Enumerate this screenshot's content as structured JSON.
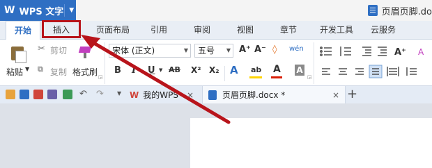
{
  "app": {
    "logo": "W",
    "name": "WPS 文字",
    "caret": "▼"
  },
  "title": {
    "document": "页眉页脚.do"
  },
  "tabs": [
    {
      "label": "开始"
    },
    {
      "label": "插入"
    },
    {
      "label": "页面布局"
    },
    {
      "label": "引用"
    },
    {
      "label": "审阅"
    },
    {
      "label": "视图"
    },
    {
      "label": "章节"
    },
    {
      "label": "开发工具"
    },
    {
      "label": "云服务"
    }
  ],
  "ribbon": {
    "paste": "粘贴",
    "cut": "剪切",
    "copy": "复制",
    "format_painter": "格式刷",
    "font_name": "宋体 (正文)",
    "font_size": "五号",
    "grow_font": "A⁺",
    "shrink_font": "A⁻",
    "clear_format": "◊",
    "phonetic": "wén",
    "bold": "B",
    "italic": "I",
    "underline": "U",
    "strike": "AB",
    "superscript": "X²",
    "subscript": "X₂",
    "text_effect": "A",
    "highlight": "ab",
    "font_color": "A",
    "char_shade": "A"
  },
  "quickbar": {
    "tab_home": "我的WPS",
    "tab_doc": "页眉页脚.docx *",
    "close": "×",
    "add": "+"
  },
  "colors": {
    "accent": "#2f6fc3",
    "annotation": "#b8141b",
    "font_color_bar": "#d81e06",
    "highlight_bar": "#ffd400"
  }
}
